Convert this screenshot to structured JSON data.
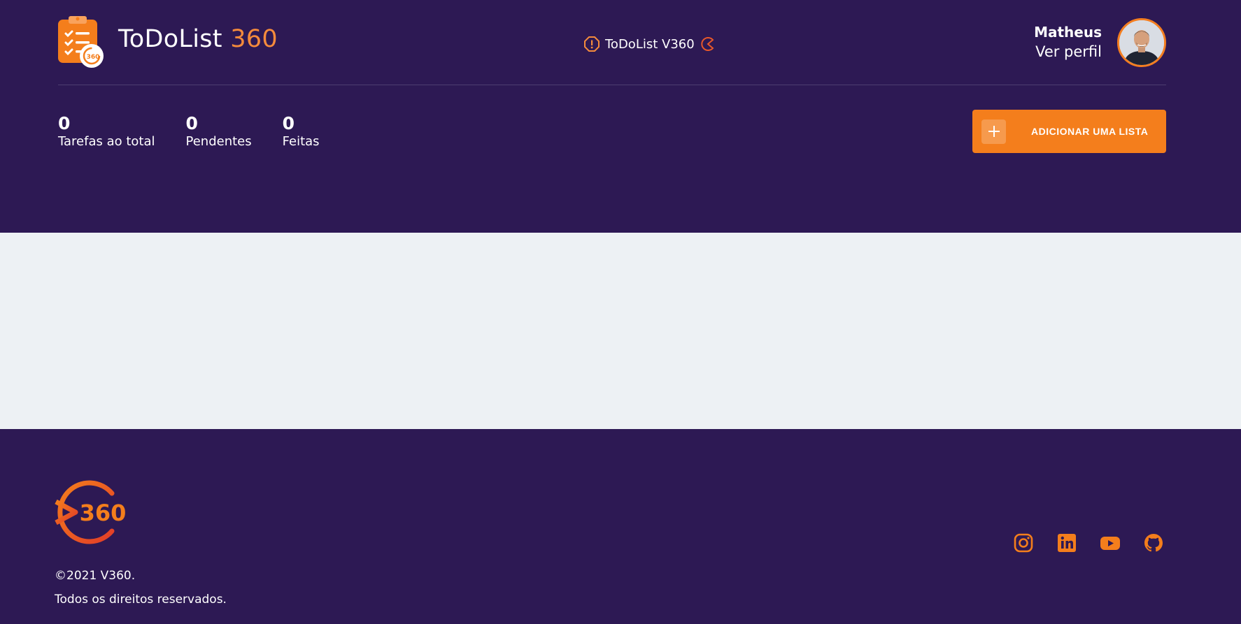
{
  "header": {
    "app_name": "ToDoList",
    "app_name_accent": "360",
    "center_badge_text": "ToDoList V360",
    "user_name": "Matheus",
    "profile_link": "Ver perfil"
  },
  "stats": [
    {
      "value": "0",
      "label": "Tarefas ao total"
    },
    {
      "value": "0",
      "label": "Pendentes"
    },
    {
      "value": "0",
      "label": "Feitas"
    }
  ],
  "actions": {
    "add_list_label": "ADICIONAR UMA LISTA"
  },
  "footer": {
    "logo_text": "360",
    "copyright": "©2021 V360.",
    "rights": "Todos os direitos reservados.",
    "social_icons": [
      "instagram-icon",
      "linkedin-icon",
      "youtube-icon",
      "github-icon"
    ]
  },
  "colors": {
    "background": "#2d1954",
    "accent": "#f47e1c",
    "content_bg": "#edf1f4",
    "text": "#ffffff"
  }
}
